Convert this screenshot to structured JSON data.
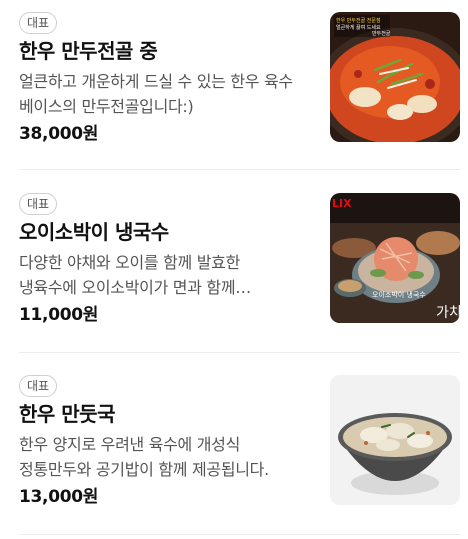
{
  "menu": {
    "items": [
      {
        "badge": "대표",
        "name": "한우 만두전골 중",
        "description": "얼큰하고 개운하게 드실 수 있는 한우 육수 베이스의 만두전골입니다:)",
        "price": "38,000원",
        "image_caption_lines": [
          "한우 만두전골 전문점",
          "얼큰하게 끓여 드세요",
          "만두전골"
        ]
      },
      {
        "badge": "대표",
        "name": "오이소박이 냉국수",
        "description": "다양한 야채와 오이를 함께 발효한 냉육수에 오이소박이가 면과 함께 제공됩니다.",
        "price": "11,000원",
        "image_caption": "오이소박이 냉국수",
        "image_logo": "LIX",
        "image_corner_text": "가치"
      },
      {
        "badge": "대표",
        "name": "한우 만둣국",
        "description": "한우 양지로 우려낸 육수에 개성식 정통만두와 공기밥이 함께 제공됩니다.",
        "price": "13,000원"
      }
    ]
  }
}
